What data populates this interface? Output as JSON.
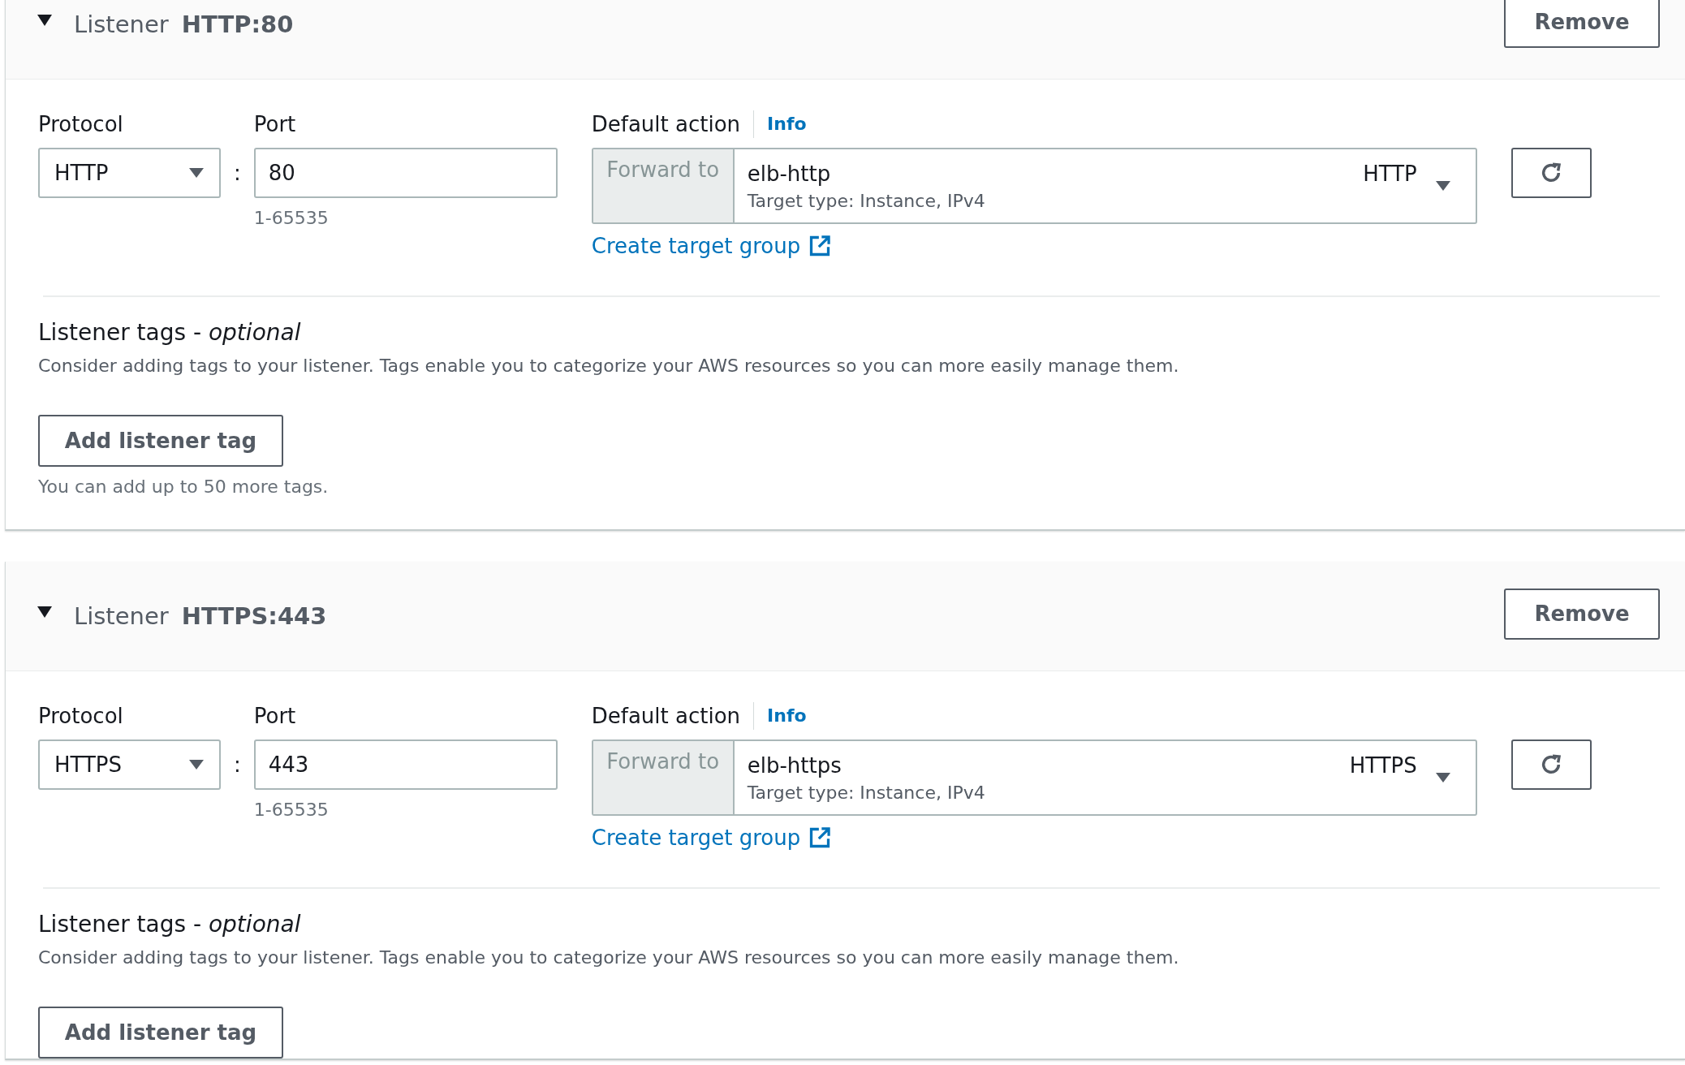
{
  "listeners": [
    {
      "expanded": true,
      "title": "Listener",
      "name": "HTTP:80",
      "remove": "Remove",
      "protocol": {
        "label": "Protocol",
        "value": "HTTP"
      },
      "separator": ":",
      "port": {
        "label": "Port",
        "value": "80",
        "hint": "1-65535"
      },
      "default_action": {
        "label": "Default action",
        "info": "Info",
        "forward_label": "Forward to",
        "target": "elb-http",
        "target_protocol": "HTTP",
        "subtext": "Target type: Instance, IPv4"
      },
      "create_link": "Create target group",
      "tags": {
        "title": "Listener tags - *optional*",
        "description": "Consider adding tags to your listener. Tags enable you to categorize your AWS resources so you can more easily manage them.",
        "button": "Add listener tag",
        "hint": "You can add up to 50 more tags."
      }
    },
    {
      "expanded": true,
      "title": "Listener",
      "name": "HTTPS:443",
      "remove": "Remove",
      "protocol": {
        "label": "Protocol",
        "value": "HTTPS"
      },
      "separator": ":",
      "port": {
        "label": "Port",
        "value": "443",
        "hint": "1-65535"
      },
      "default_action": {
        "label": "Default action",
        "info": "Info",
        "forward_label": "Forward to",
        "target": "elb-https",
        "target_protocol": "HTTPS",
        "subtext": "Target type: Instance, IPv4"
      },
      "create_link": "Create target group",
      "tags": {
        "title": "Listener tags - *optional*",
        "description": "Consider adding tags to your listener. Tags enable you to categorize your AWS resources so you can more easily manage them.",
        "button": "Add listener tag"
      }
    }
  ]
}
